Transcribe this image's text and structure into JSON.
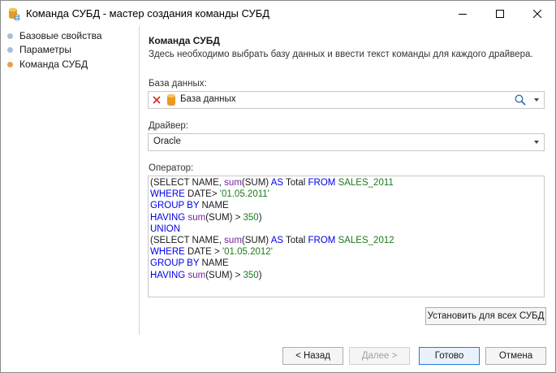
{
  "window": {
    "title": "Команда СУБД - мастер создания команды СУБД",
    "minimize_icon": "minimize-icon",
    "maximize_icon": "maximize-icon",
    "close_icon": "close-icon"
  },
  "nav": {
    "items": [
      {
        "label": "Базовые свойства",
        "dot_color": "#a9bfd6",
        "active": false
      },
      {
        "label": "Параметры",
        "dot_color": "#a9bfd6",
        "active": false
      },
      {
        "label": "Команда СУБД",
        "dot_color": "#e8a24a",
        "active": true
      }
    ]
  },
  "page": {
    "title": "Команда СУБД",
    "description": "Здесь необходимо выбрать базу данных и ввести текст команды для каждого драйвера.",
    "database_label": "База данных:",
    "database_value": "База данных",
    "driver_label": "Драйвер:",
    "driver_value": "Oracle",
    "operator_label": "Оператор:"
  },
  "code": [
    [
      [
        "tx",
        "(SELECT NAME, "
      ],
      [
        "fn",
        "sum"
      ],
      [
        "tx",
        "(SUM) "
      ],
      [
        "kw",
        "AS"
      ],
      [
        "tx",
        " Total "
      ],
      [
        "kw",
        "FROM"
      ],
      [
        "str",
        " SALES_2011"
      ]
    ],
    [
      [
        "kw",
        "WHERE"
      ],
      [
        "tx",
        " DATE> "
      ],
      [
        "str",
        "'01.05.2011'"
      ]
    ],
    [
      [
        "kw",
        "GROUP BY"
      ],
      [
        "tx",
        " NAME"
      ]
    ],
    [
      [
        "kw",
        "HAVING"
      ],
      [
        "tx",
        " "
      ],
      [
        "fn",
        "sum"
      ],
      [
        "tx",
        "(SUM) > "
      ],
      [
        "nm",
        "350"
      ],
      [
        "tx",
        ")"
      ]
    ],
    [
      [
        "kw",
        "UNION"
      ]
    ],
    [
      [
        "tx",
        "(SELECT NAME, "
      ],
      [
        "fn",
        "sum"
      ],
      [
        "tx",
        "(SUM) "
      ],
      [
        "kw",
        "AS"
      ],
      [
        "tx",
        " Total "
      ],
      [
        "kw",
        "FROM"
      ],
      [
        "str",
        " SALES_2012"
      ]
    ],
    [
      [
        "kw",
        "WHERE"
      ],
      [
        "tx",
        " DATE > "
      ],
      [
        "str",
        "'01.05.2012'"
      ]
    ],
    [
      [
        "kw",
        "GROUP BY"
      ],
      [
        "tx",
        " NAME"
      ]
    ],
    [
      [
        "kw",
        "HAVING"
      ],
      [
        "tx",
        " "
      ],
      [
        "fn",
        "sum"
      ],
      [
        "tx",
        "(SUM) > "
      ],
      [
        "nm",
        "350"
      ],
      [
        "tx",
        ")"
      ]
    ]
  ],
  "buttons": {
    "set_all": "Установить для всех СУБД",
    "back": "< Назад",
    "next": "Далее >",
    "finish": "Готово",
    "cancel": "Отмена"
  },
  "colors": {
    "accent": "#2b79d8",
    "keyword": "#0000e6",
    "function": "#7a1fa2",
    "string": "#1a7a1a",
    "clear_icon": "#d9281f",
    "db_icon": "#f0a630"
  }
}
